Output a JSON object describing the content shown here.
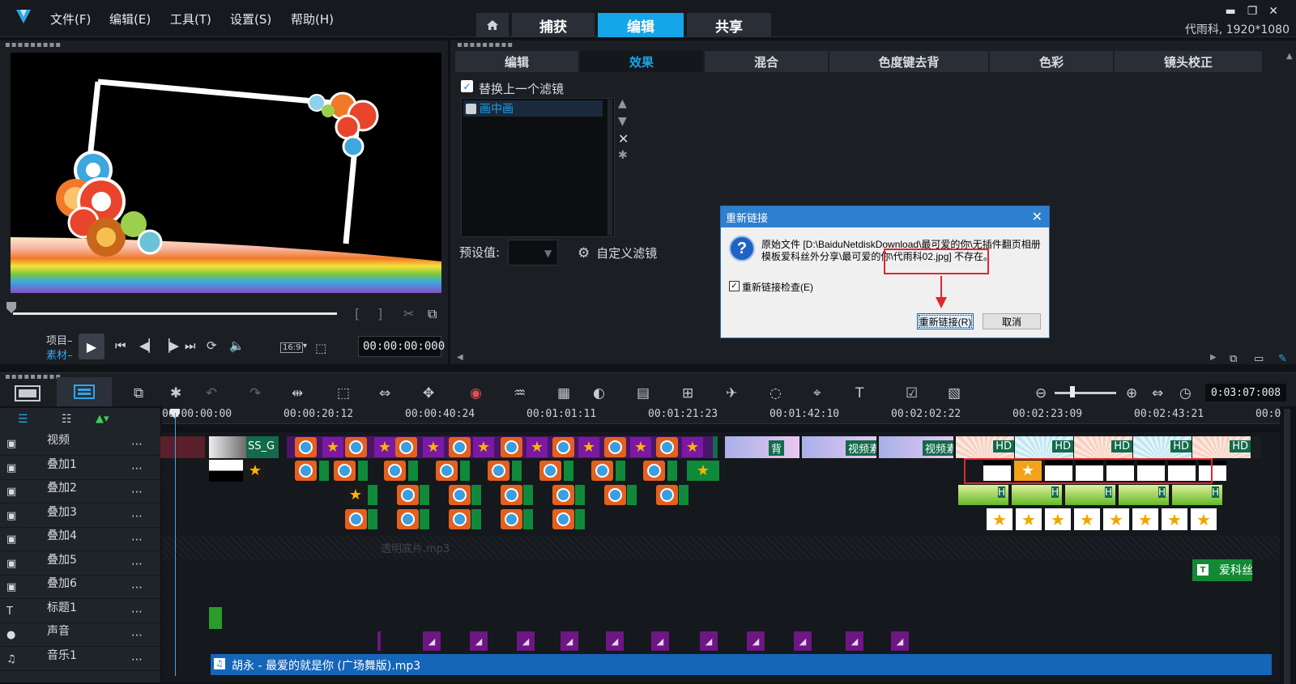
{
  "app": {
    "logo_icon": "corel-logo-icon"
  },
  "menu": [
    "文件(F)",
    "编辑(E)",
    "工具(T)",
    "设置(S)",
    "帮助(H)"
  ],
  "nav": {
    "home_icon": "home-icon",
    "tabs": [
      "捕获",
      "编辑",
      "共享"
    ],
    "active": "编辑"
  },
  "window_controls": [
    "▬",
    "❐",
    "✕"
  ],
  "project_info": "代雨科, 1920*1080",
  "preview": {
    "project_label": "项目–",
    "clip_label": "素材–",
    "timecode": "00:00:00:000",
    "aspect": "16:9"
  },
  "options": {
    "tabs": [
      "编辑",
      "效果",
      "混合",
      "色度键去背",
      "色彩",
      "镜头校正"
    ],
    "active_tab": "效果",
    "replace_filter_label": "替换上一个滤镜",
    "replace_filter_checked": true,
    "filters": [
      "画中画"
    ],
    "preset_label": "预设值:",
    "custom_filter_label": "自定义滤镜"
  },
  "dialog": {
    "title": "重新链接",
    "message": "原始文件 [D:\\BaiduNetdiskDownload\\最可爱的你\\无插件翻页相册模板爱科丝外分享\\最可爱的你\\代雨科02.jpg] 不存在。",
    "checkbox_label": "重新链接检查(E)",
    "checkbox_checked": true,
    "relink_button": "重新链接(R)",
    "cancel_button": "取消",
    "accent_color": "#2d7fd0"
  },
  "timeline": {
    "total_time": "0:03:07:008",
    "ruler_ticks": [
      "00:00:00:00",
      "00:00:20:12",
      "00:00:40:24",
      "00:01:01:11",
      "00:01:21:23",
      "00:01:42:10",
      "00:02:02:22",
      "00:02:23:09",
      "00:02:43:21",
      "00:0"
    ],
    "tracks": [
      {
        "icon": "video-track-icon",
        "name": "视频"
      },
      {
        "icon": "overlay-track-icon-1",
        "name": "叠加1"
      },
      {
        "icon": "overlay-track-icon-2",
        "name": "叠加2"
      },
      {
        "icon": "overlay-track-icon-3",
        "name": "叠加3"
      },
      {
        "icon": "overlay-track-icon-4",
        "name": "叠加4"
      },
      {
        "icon": "overlay-track-icon-5",
        "name": "叠加5"
      },
      {
        "icon": "overlay-track-icon-6",
        "name": "叠加6"
      },
      {
        "icon": "title-track-icon",
        "name": "标题1"
      },
      {
        "icon": "voice-track-icon",
        "name": "声音"
      },
      {
        "icon": "music-track-icon",
        "name": "音乐1"
      }
    ],
    "video_clip_labels": [
      "SS_G",
      "背",
      "视频素",
      "视频素",
      "视频素",
      "HD",
      "HD",
      "HD",
      "HD",
      "HD"
    ],
    "ghost_clip_label": "透明底片.mp3",
    "title_clip_label": "爱科丝",
    "music_clip_label": "胡永 - 最爱的就是你 (广场舞版).mp3"
  }
}
